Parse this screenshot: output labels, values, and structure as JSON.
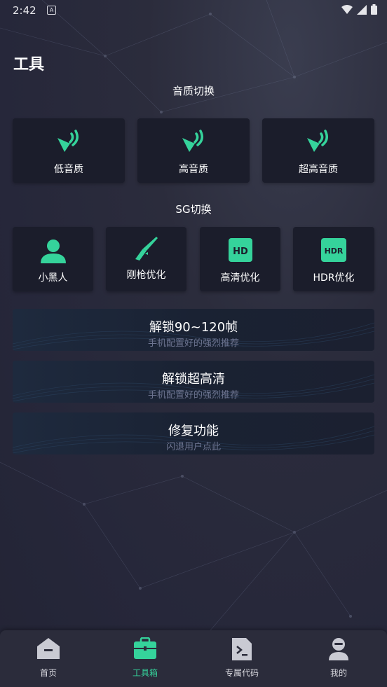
{
  "status_bar": {
    "time": "2:42",
    "notif_letter": "A"
  },
  "page": {
    "title": "工具"
  },
  "audio": {
    "section_title": "音质切换",
    "options": [
      {
        "label": "低音质",
        "icon": "speaker-icon"
      },
      {
        "label": "高音质",
        "icon": "speaker-icon"
      },
      {
        "label": "超高音质",
        "icon": "speaker-icon"
      }
    ]
  },
  "sg": {
    "section_title": "SG切换",
    "options": [
      {
        "label": "小黑人",
        "icon": "person-icon"
      },
      {
        "label": "刚枪优化",
        "icon": "rifle-icon"
      },
      {
        "label": "高清优化",
        "icon": "hd-icon"
      },
      {
        "label": "HDR优化",
        "icon": "hdr-icon"
      }
    ]
  },
  "actions": [
    {
      "title": "解锁90~120帧",
      "subtitle": "手机配置好的强烈推荐"
    },
    {
      "title": "解锁超高清",
      "subtitle": "手机配置好的强烈推荐"
    },
    {
      "title": "修复功能",
      "subtitle": "闪退用户点此"
    }
  ],
  "tabbar": {
    "active": "工具箱",
    "tabs": [
      {
        "label": "首页",
        "icon": "home-icon"
      },
      {
        "label": "工具箱",
        "icon": "toolbox-icon"
      },
      {
        "label": "专属代码",
        "icon": "code-file-icon"
      },
      {
        "label": "我的",
        "icon": "profile-icon"
      }
    ]
  },
  "colors": {
    "accent": "#35d39b",
    "card": "#1b1d2b",
    "background": "#26273a",
    "subtext": "#6e7591"
  }
}
